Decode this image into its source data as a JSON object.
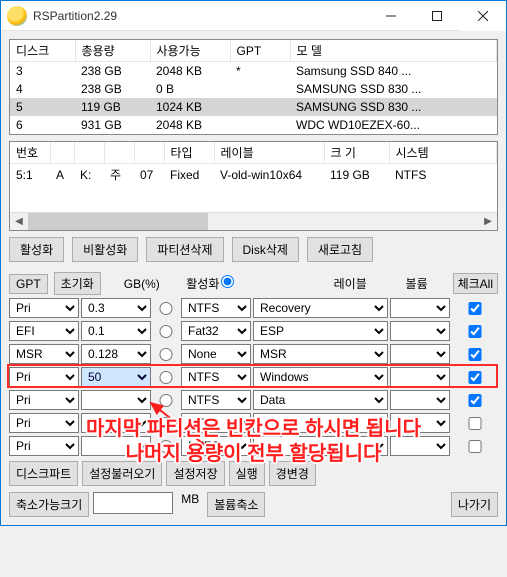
{
  "window": {
    "title": "RSPartition2.29"
  },
  "diskTable": {
    "headers": [
      "디스크",
      "총용량",
      "사용가능",
      "GPT",
      "모  델"
    ],
    "rows": [
      {
        "disk": "3",
        "total": "238 GB",
        "avail": "2048 KB",
        "gpt": "*",
        "model": "Samsung SSD 840 ...",
        "selected": false
      },
      {
        "disk": "4",
        "total": "238 GB",
        "avail": "0 B",
        "gpt": "",
        "model": "SAMSUNG SSD 830 ...",
        "selected": false
      },
      {
        "disk": "5",
        "total": "119 GB",
        "avail": "1024 KB",
        "gpt": "",
        "model": "SAMSUNG SSD 830 ...",
        "selected": true
      },
      {
        "disk": "6",
        "total": "931 GB",
        "avail": "2048 KB",
        "gpt": "",
        "model": "WDC WD10EZEX-60...",
        "selected": false
      }
    ]
  },
  "partTable": {
    "headers": [
      "번호",
      "",
      "",
      "",
      "",
      "타입",
      "레이블",
      "크 기",
      "시스템"
    ],
    "rows": [
      {
        "c0": "5:1",
        "c1": "A",
        "c2": "K:",
        "c3": "주",
        "c4": "07",
        "c5": "Fixed",
        "c6": "V-old-win10x64",
        "c7": "119 GB",
        "c8": "NTFS"
      }
    ]
  },
  "buttons": {
    "activate": "활성화",
    "deactivate": "비활성화",
    "delPartition": "파티션삭제",
    "delDisk": "Disk삭제",
    "refresh": "새로고침",
    "gpt": "GPT",
    "init": "초기화",
    "checkAll": "체크All"
  },
  "configHead": {
    "gb": "GB(%)",
    "act": "활성화",
    "label": "레이블",
    "vol": "볼륨"
  },
  "configRows": [
    {
      "type": "Pri",
      "gb": "0.3",
      "fs": "NTFS",
      "label": "Recovery",
      "checked": true
    },
    {
      "type": "EFI",
      "gb": "0.1",
      "fs": "Fat32",
      "label": "ESP",
      "checked": true
    },
    {
      "type": "MSR",
      "gb": "0.128",
      "fs": "None",
      "label": "MSR",
      "checked": true
    },
    {
      "type": "Pri",
      "gb": "50",
      "fs": "NTFS",
      "label": "Windows",
      "checked": true,
      "highlight": true,
      "gbHighlight": true
    },
    {
      "type": "Pri",
      "gb": "",
      "fs": "NTFS",
      "label": "Data",
      "checked": true
    },
    {
      "type": "Pri",
      "gb": "",
      "fs": "NTFS",
      "label": "",
      "checked": false
    },
    {
      "type": "Pri",
      "gb": "",
      "fs": "NTFS",
      "label": "",
      "checked": false
    }
  ],
  "annotation": {
    "line1": "마지막 파티션은 빈칸으로 하시면 됩니다",
    "line2": "나머지 용량이 전부 할당됩니다"
  },
  "bottom": {
    "diskpart": "디스크파트",
    "configLoad": "설정불러오기",
    "configSave": "설정저장",
    "run": "실행",
    "changeDrive": "경변경",
    "shrink": "축소가능크기",
    "mb": "MB",
    "create": "볼륨축소",
    "exit": "나가기"
  }
}
